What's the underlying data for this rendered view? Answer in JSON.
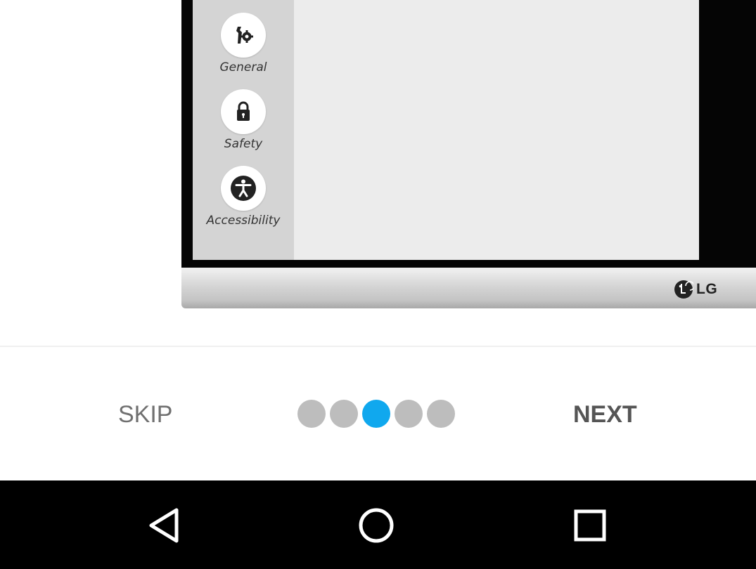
{
  "tv_menu": {
    "items": [
      {
        "label": "General",
        "icon": "wrench-gear-icon"
      },
      {
        "label": "Safety",
        "icon": "lock-icon"
      },
      {
        "label": "Accessibility",
        "icon": "accessibility-icon"
      }
    ]
  },
  "brand": {
    "logo_text": "LG"
  },
  "tutorial": {
    "skip_label": "SKIP",
    "next_label": "NEXT",
    "page_count": 5,
    "current_page": 3
  },
  "navbar": {
    "back_icon": "back-triangle-icon",
    "home_icon": "home-circle-icon",
    "recents_icon": "recents-square-icon"
  },
  "colors": {
    "active_dot": "#10a8ee",
    "inactive_dot": "#bdbdbd",
    "navbar_bg": "#000000"
  }
}
